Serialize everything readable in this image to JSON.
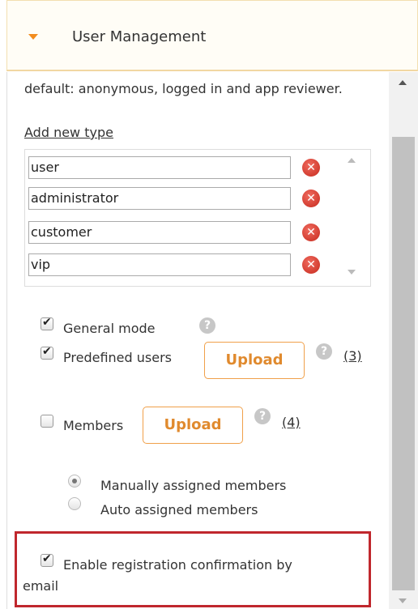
{
  "panel": {
    "title": "User Management"
  },
  "user_types": {
    "description": "default: anonymous, logged in and app reviewer.",
    "add_link": "Add new type",
    "items": [
      "user",
      "administrator",
      "customer",
      "vip"
    ],
    "delete_icon": "x-circle-icon"
  },
  "options": {
    "general_mode": {
      "label": "General mode",
      "checked": true
    },
    "predefined_users": {
      "label": "Predefined users",
      "checked": true,
      "upload_label": "Upload",
      "count": "(3)"
    },
    "members": {
      "label": "Members",
      "checked": false,
      "upload_label": "Upload",
      "count": "(4)"
    },
    "assignment": [
      {
        "label": "Manually assigned members",
        "selected": true
      },
      {
        "label": "Auto assigned members",
        "selected": false
      }
    ],
    "registration_confirmation": {
      "label": "Enable registration confirmation by",
      "label_line2": "email",
      "checked": true
    }
  },
  "colors": {
    "accent": "#f28c1e",
    "highlight": "#c0272d",
    "delete": "#d23b2e"
  }
}
